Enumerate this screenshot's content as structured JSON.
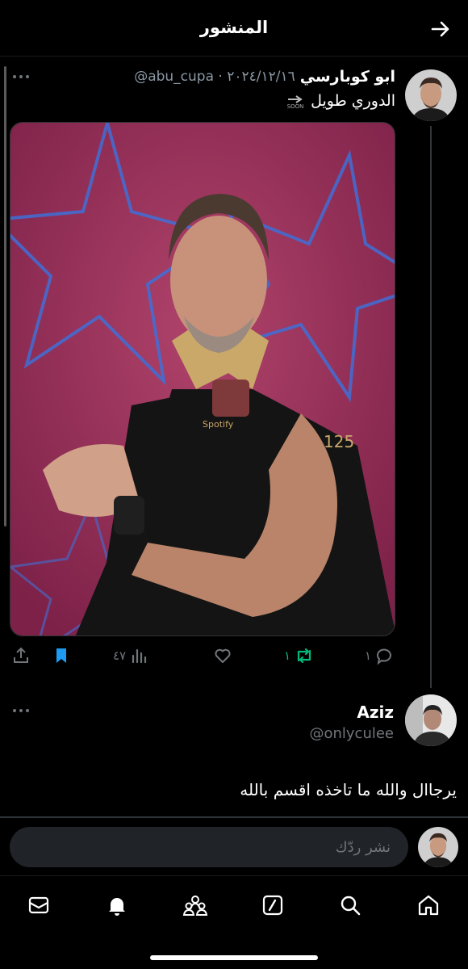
{
  "header": {
    "title": "المنشور"
  },
  "post": {
    "display_name": "ابو كوبارسي",
    "handle_date": "@abu_cupa · ٢٠٢٤/١٢/١٦",
    "text": "الدوري طويل",
    "badge": "SOON",
    "stats": {
      "views": "٤٧",
      "retweets": "١",
      "replies": "١",
      "likes": ""
    },
    "media_text": {
      "sponsor": "Spotify",
      "sleeve": "125"
    }
  },
  "reply": {
    "display_name": "Aziz",
    "handle": "@onlyculee",
    "text": "يرجاال والله ما تاخذه اقسم بالله"
  },
  "composer": {
    "placeholder": "نشر ردّك"
  },
  "colors": {
    "accent": "#1d9bf0",
    "retweet_active": "#00ba7c",
    "muted": "#71767b"
  },
  "icons": [
    "back-arrow-icon",
    "more-icon",
    "share-icon",
    "bookmark-icon",
    "views-icon",
    "like-icon",
    "retweet-icon",
    "reply-icon",
    "mail-icon",
    "bell-icon",
    "communities-icon",
    "grok-icon",
    "search-icon",
    "home-icon"
  ]
}
